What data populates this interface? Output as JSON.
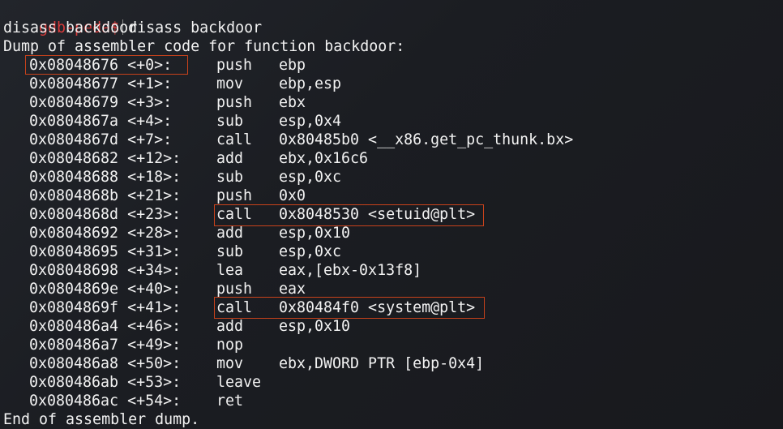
{
  "prompt": {
    "label": "gdb-peda$",
    "command": "disass backdoor"
  },
  "echo": "disass backdoor",
  "header": "Dump of assembler code for function backdoor:",
  "rows": [
    {
      "addr": "0x08048676 <+0>:",
      "mnem": "push",
      "ops": "ebp"
    },
    {
      "addr": "0x08048677 <+1>:",
      "mnem": "mov",
      "ops": "ebp,esp"
    },
    {
      "addr": "0x08048679 <+3>:",
      "mnem": "push",
      "ops": "ebx"
    },
    {
      "addr": "0x0804867a <+4>:",
      "mnem": "sub",
      "ops": "esp,0x4"
    },
    {
      "addr": "0x0804867d <+7>:",
      "mnem": "call",
      "ops": "0x80485b0 <__x86.get_pc_thunk.bx>"
    },
    {
      "addr": "0x08048682 <+12>:",
      "mnem": "add",
      "ops": "ebx,0x16c6"
    },
    {
      "addr": "0x08048688 <+18>:",
      "mnem": "sub",
      "ops": "esp,0xc"
    },
    {
      "addr": "0x0804868b <+21>:",
      "mnem": "push",
      "ops": "0x0"
    },
    {
      "addr": "0x0804868d <+23>:",
      "mnem": "call",
      "ops": "0x8048530 <setuid@plt>"
    },
    {
      "addr": "0x08048692 <+28>:",
      "mnem": "add",
      "ops": "esp,0x10"
    },
    {
      "addr": "0x08048695 <+31>:",
      "mnem": "sub",
      "ops": "esp,0xc"
    },
    {
      "addr": "0x08048698 <+34>:",
      "mnem": "lea",
      "ops": "eax,[ebx-0x13f8]"
    },
    {
      "addr": "0x0804869e <+40>:",
      "mnem": "push",
      "ops": "eax"
    },
    {
      "addr": "0x0804869f <+41>:",
      "mnem": "call",
      "ops": "0x80484f0 <system@plt>"
    },
    {
      "addr": "0x080486a4 <+46>:",
      "mnem": "add",
      "ops": "esp,0x10"
    },
    {
      "addr": "0x080486a7 <+49>:",
      "mnem": "nop",
      "ops": ""
    },
    {
      "addr": "0x080486a8 <+50>:",
      "mnem": "mov",
      "ops": "ebx,DWORD PTR [ebp-0x4]"
    },
    {
      "addr": "0x080486ab <+53>:",
      "mnem": "leave",
      "ops": ""
    },
    {
      "addr": "0x080486ac <+54>:",
      "mnem": "ret",
      "ops": ""
    }
  ],
  "footer": "End of assembler dump.",
  "colors": {
    "prompt": "#d93a3a",
    "text": "#f2f2f2",
    "highlight_box": "#c8421b",
    "background": "#1b1d22"
  }
}
